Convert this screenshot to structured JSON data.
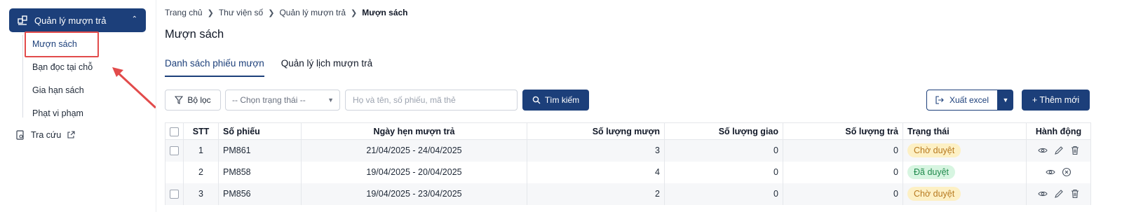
{
  "sidebar": {
    "group_label": "Quản lý mượn trả",
    "items": [
      {
        "label": "Mượn sách"
      },
      {
        "label": "Bạn đọc tại chỗ"
      },
      {
        "label": "Gia hạn sách"
      },
      {
        "label": "Phạt vi phạm"
      }
    ],
    "lookup_label": "Tra cứu"
  },
  "breadcrumb": [
    "Trang chủ",
    "Thư viện số",
    "Quản lý mượn trả",
    "Mượn sách"
  ],
  "page_title": "Mượn sách",
  "tabs": [
    {
      "label": "Danh sách phiếu mượn",
      "active": true
    },
    {
      "label": "Quản lý lịch mượn trả",
      "active": false
    }
  ],
  "toolbar": {
    "filter_label": "Bộ lọc",
    "status_placeholder": "-- Chọn trạng thái --",
    "search_placeholder": "Họ và tên, số phiếu, mã thẻ",
    "search_label": "Tìm kiếm",
    "export_label": "Xuất excel",
    "add_label": "+ Thêm mới"
  },
  "table": {
    "headers": [
      "STT",
      "Số phiếu",
      "Ngày hẹn mượn trả",
      "Số lượng mượn",
      "Số lượng giao",
      "Số lượng trả",
      "Trạng thái",
      "Hành động"
    ],
    "rows": [
      {
        "stt": "1",
        "code": "PM861",
        "dates": "21/04/2025 - 24/04/2025",
        "borrowed": "3",
        "delivered": "0",
        "returned": "0",
        "status": "Chờ duyệt"
      },
      {
        "stt": "2",
        "code": "PM858",
        "dates": "19/04/2025 - 20/04/2025",
        "borrowed": "4",
        "delivered": "0",
        "returned": "0",
        "status": "Đã duyệt"
      },
      {
        "stt": "3",
        "code": "PM856",
        "dates": "19/04/2025 - 23/04/2025",
        "borrowed": "2",
        "delivered": "0",
        "returned": "0",
        "status": "Chờ duyệt"
      }
    ]
  },
  "colors": {
    "primary": "#1c3f7a",
    "highlight": "#e24b4b",
    "pending_bg": "#fdf0c4",
    "approved_bg": "#d7f5e1"
  }
}
